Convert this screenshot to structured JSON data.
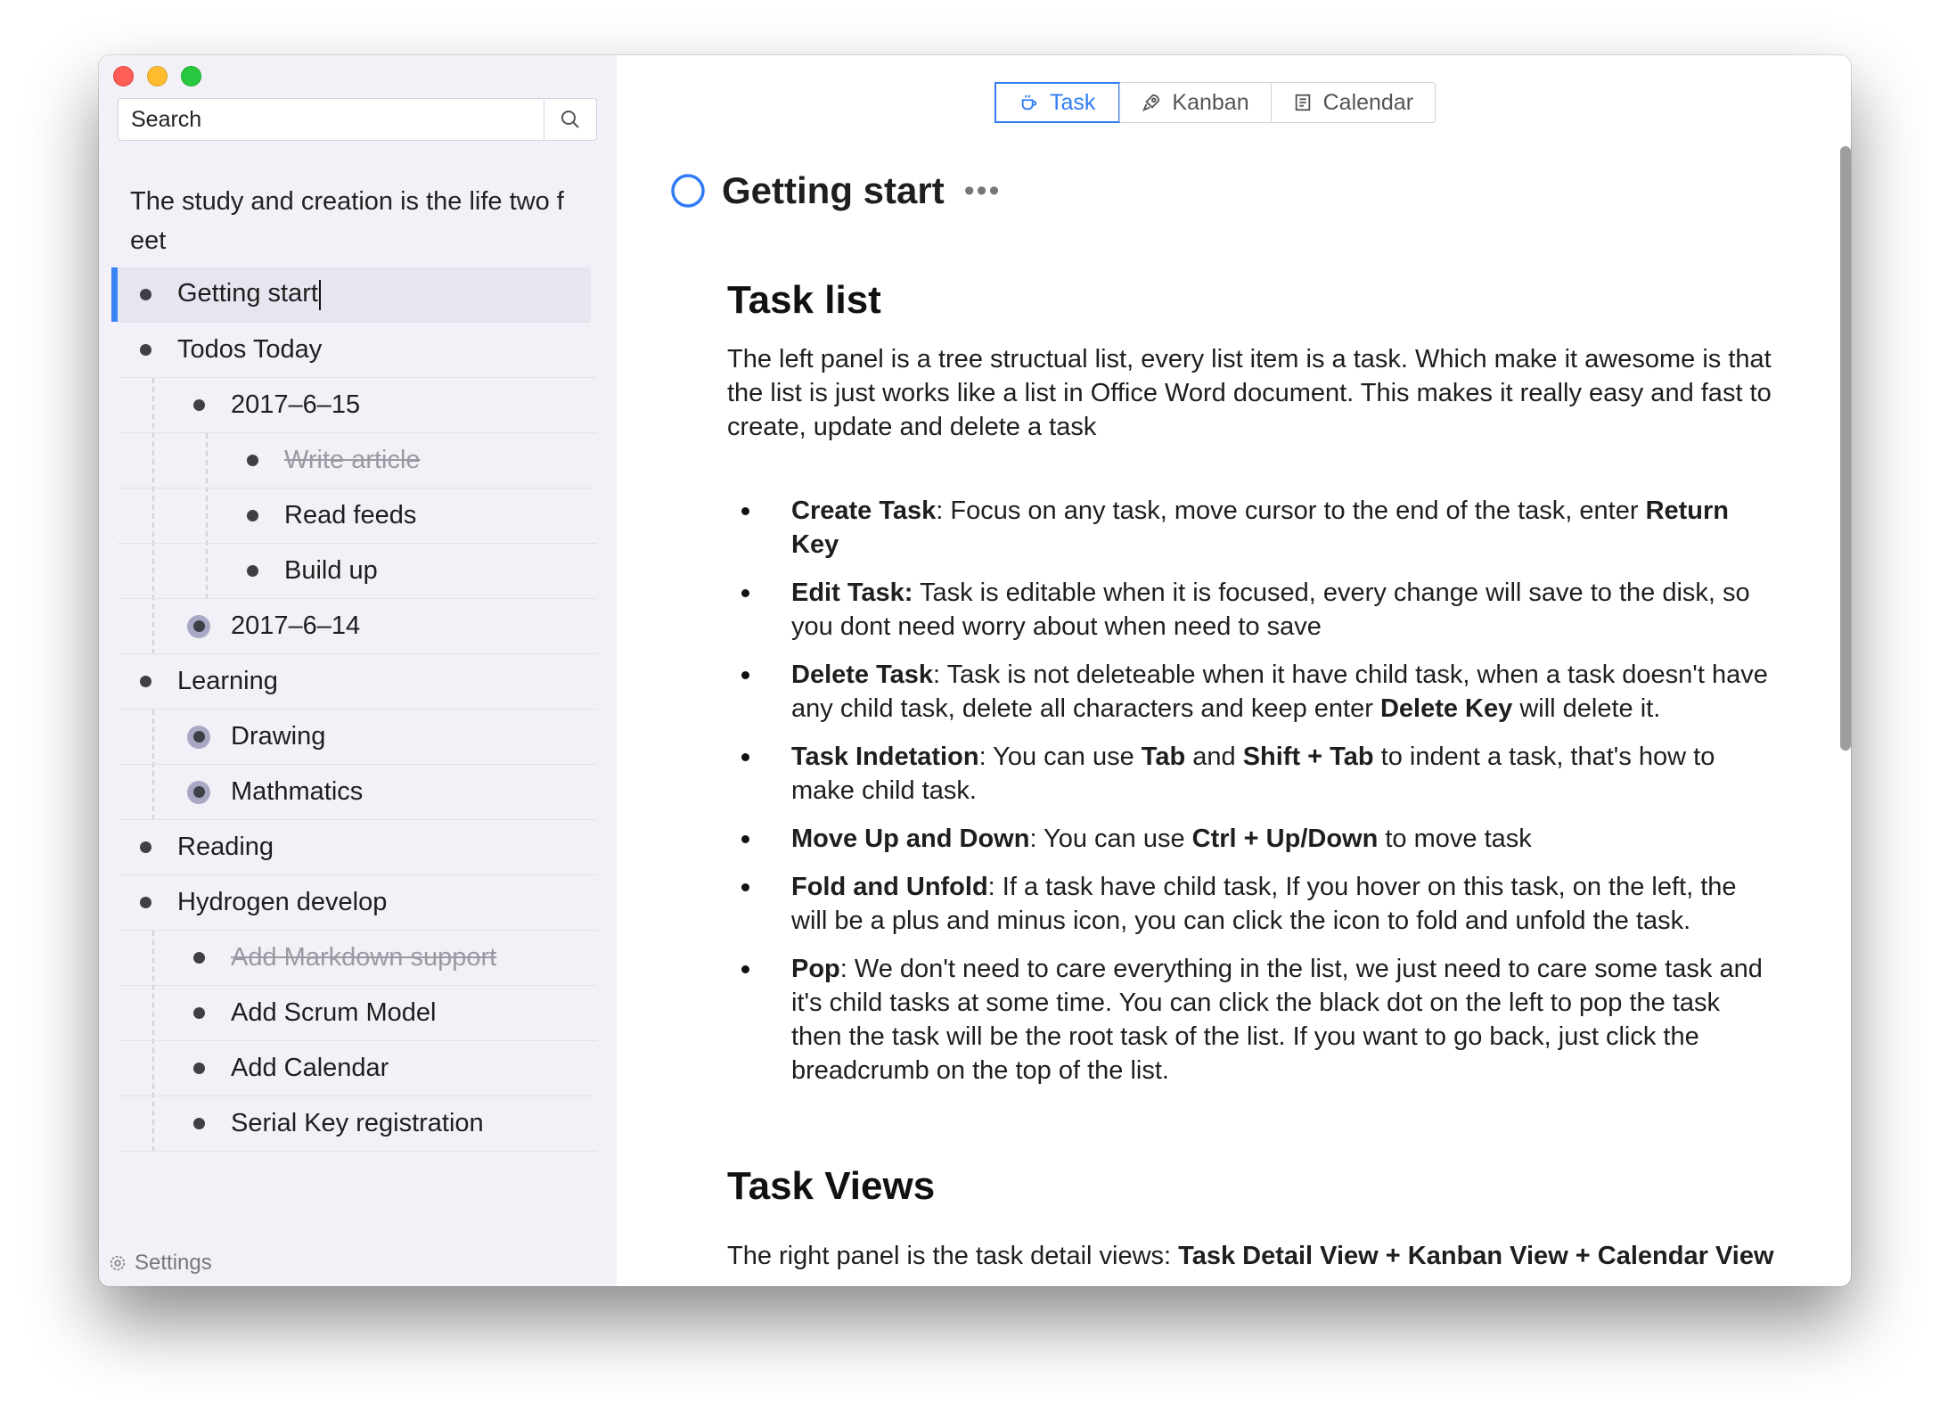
{
  "search": {
    "placeholder": "Search"
  },
  "breadcrumb": "The study and creation is the life two f eet",
  "tree": {
    "getting_start": "Getting start",
    "todos_today": "Todos Today",
    "date_1": "2017–6–15",
    "write_article": "Write article",
    "read_feeds": "Read feeds",
    "build_up": "Build up",
    "date_2": "2017–6–14",
    "learning": "Learning",
    "drawing": "Drawing",
    "mathmatics": "Mathmatics",
    "reading": "Reading",
    "hydrogen": "Hydrogen develop",
    "add_markdown": "Add Markdown support",
    "add_scrum": "Add Scrum Model",
    "add_calendar": "Add Calendar",
    "serial_key": "Serial Key registration"
  },
  "settings_label": "Settings",
  "tabs": {
    "task": "Task",
    "kanban": "Kanban",
    "calendar": "Calendar"
  },
  "task_title": "Getting start",
  "more": "•••",
  "doc": {
    "h_task_list": "Task list",
    "intro": "The left panel is a tree structual list, every list item is a task. Which make it awesome is that the list is just works like a list in Office Word document. This makes it really easy and fast to create, update and delete a task",
    "items": {
      "create": {
        "label": "Create Task",
        "text_a": ":  Focus on any task, move cursor to the end of the task, enter ",
        "key": "Return Key"
      },
      "edit": {
        "label": "Edit Task:",
        "text": " Task is editable when it is focused, every change will save to the disk, so you dont need worry about when need to save"
      },
      "delete": {
        "label": "Delete Task",
        "text_a": ": Task is not deleteable when it have child task, when a task doesn't have any child task, delete all characters and keep enter ",
        "key": "Delete Key",
        "text_b": " will delete it."
      },
      "indent": {
        "label": "Task Indetation",
        "text_a": ": You can use ",
        "k1": "Tab",
        "text_b": " and ",
        "k2": "Shift + Tab",
        "text_c": " to indent a task, that's how to make child task."
      },
      "move": {
        "label": "Move Up and Down",
        "text_a": ": You can use ",
        "key": "Ctrl + Up/Down",
        "text_b": " to move task"
      },
      "fold": {
        "label": "Fold and Unfold",
        "text": ": If a task have child task, If you hover on this task, on the left, the will be a plus and minus icon, you can click the icon to fold and unfold the task."
      },
      "pop": {
        "label": "Pop",
        "text": ": We don't need to care everything in the list, we just need to care some task and it's child tasks at some time. You can click the black dot on the left to pop the task then the task will be the root task of the list. If you want to go back, just click the breadcrumb on the top of the list."
      }
    },
    "h_task_views": "Task Views",
    "views_text": "The right panel is the task detail views: ",
    "views_bold": "Task Detail View + Kanban View + Calendar View"
  },
  "colors": {
    "accent": "#2f7cf6",
    "active_bar": "#3b82f6",
    "sidebar_bg": "#f1f1f7"
  }
}
